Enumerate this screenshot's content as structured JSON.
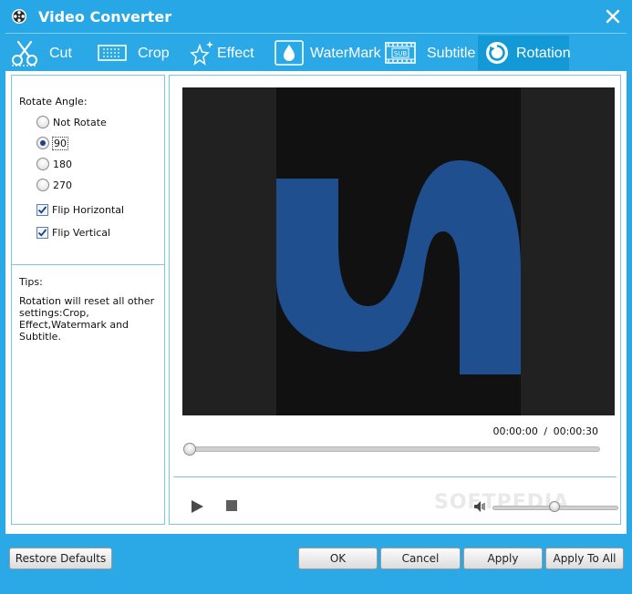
{
  "window": {
    "title": "Video Converter",
    "app_icon": "film-reel-icon",
    "close_icon": "close-icon"
  },
  "tabs": [
    {
      "label": "Cut",
      "icon": "scissors-icon",
      "active": false
    },
    {
      "label": "Crop",
      "icon": "crop-icon",
      "active": false
    },
    {
      "label": "Effect",
      "icon": "sparkle-icon",
      "active": false
    },
    {
      "label": "WaterMark",
      "icon": "watermark-drop-icon",
      "active": false
    },
    {
      "label": "Subtitle",
      "icon": "subtitle-film-icon",
      "active": false
    },
    {
      "label": "Rotation",
      "icon": "rotate-icon",
      "active": true
    }
  ],
  "rotate": {
    "heading": "Rotate Angle:",
    "options": [
      {
        "label": "Not Rotate",
        "checked": false
      },
      {
        "label": "90",
        "checked": true
      },
      {
        "label": "180",
        "checked": false
      },
      {
        "label": "270",
        "checked": false
      }
    ],
    "flips": [
      {
        "label": "Flip Horizontal",
        "checked": true
      },
      {
        "label": "Flip Vertical",
        "checked": true
      }
    ]
  },
  "tips": {
    "heading": "Tips:",
    "text": "Rotation will reset all other settings:Crop, Effect,Watermark and Subtitle."
  },
  "player": {
    "current_time": "00:00:00",
    "separator": "/",
    "total_time": "00:00:30",
    "progress": 0.0,
    "volume": 0.55,
    "watermark_text": "SOFTPEDIA",
    "colors": {
      "video_bg": "#212121",
      "frame_bg": "#111111",
      "logo_blue": "#1f4f8f"
    }
  },
  "buttons": {
    "restore_defaults": "Restore Defaults",
    "ok": "OK",
    "cancel": "Cancel",
    "apply": "Apply",
    "apply_to_all": "Apply To All"
  },
  "colors": {
    "chrome": "#2aa9e6",
    "active_tab": "#139ad6",
    "panel_border": "#7cc6ea"
  }
}
